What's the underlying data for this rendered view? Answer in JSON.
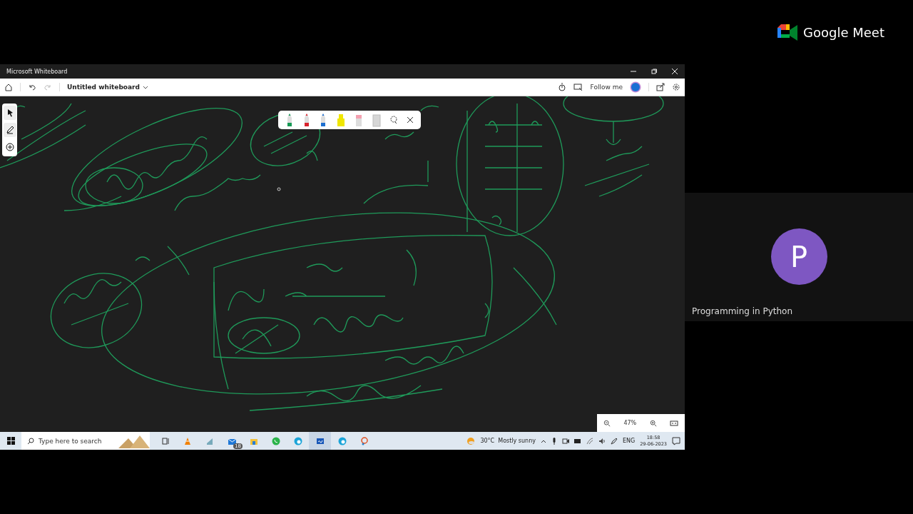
{
  "window": {
    "title": "Microsoft Whiteboard"
  },
  "toolbar": {
    "board_name": "Untitled whiteboard",
    "follow_label": "Follow me"
  },
  "tool_rail": [
    {
      "kind": "select"
    },
    {
      "kind": "pen"
    },
    {
      "kind": "add"
    }
  ],
  "pens": [
    {
      "kind": "pen",
      "color": "#179a55"
    },
    {
      "kind": "pen",
      "color": "#d9232e"
    },
    {
      "kind": "pen",
      "color": "#1e6fd0"
    },
    {
      "kind": "highlighter",
      "color": "#f0e600"
    },
    {
      "kind": "eraser"
    },
    {
      "kind": "ruler"
    },
    {
      "kind": "lasso"
    }
  ],
  "zoom": {
    "reading": "47%"
  },
  "taskbar": {
    "search_placeholder": "Type here to search",
    "apps": [
      {
        "kind": "taskview",
        "selected": false
      },
      {
        "kind": "vlc",
        "selected": false
      },
      {
        "kind": "app",
        "selected": false
      },
      {
        "kind": "mail",
        "selected": false,
        "badge": "18"
      },
      {
        "kind": "explorer",
        "selected": false
      },
      {
        "kind": "whatsapp",
        "selected": false
      },
      {
        "kind": "edge",
        "selected": false
      },
      {
        "kind": "whiteboard",
        "selected": true
      },
      {
        "kind": "edge",
        "selected": false
      },
      {
        "kind": "paint",
        "selected": false
      }
    ],
    "weather": "30°C  Mostly sunny",
    "language": "ENG",
    "time": "18:58",
    "date": "29-06-2023"
  },
  "meet": {
    "brand": "Google Meet",
    "participant": {
      "initial": "P",
      "name": "Programming in Python",
      "color": "#7e57c2"
    }
  }
}
